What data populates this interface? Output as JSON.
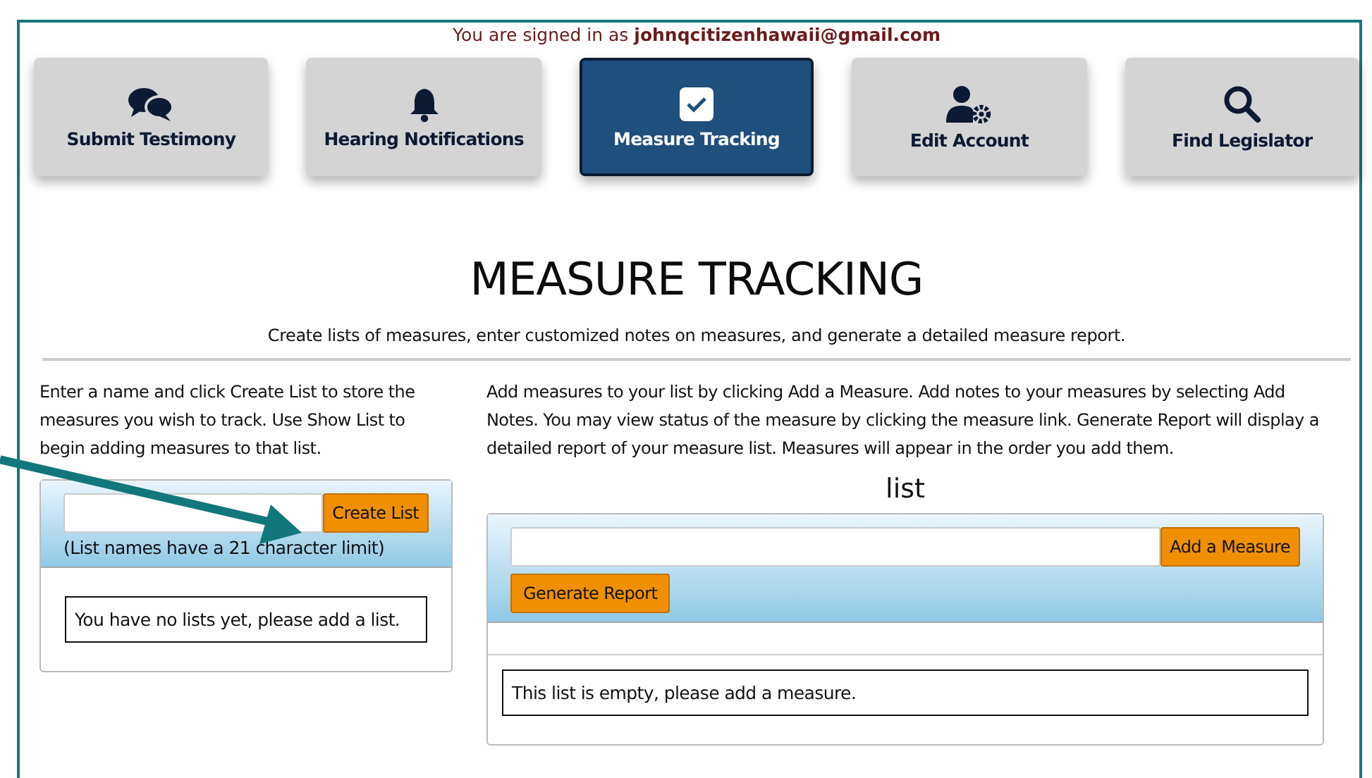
{
  "signed_in": "You are signed in as **johnqcitizenhawaii@gmail.com**",
  "nav": [
    {
      "label": "Submit Testimony",
      "kind": "chat",
      "selected": false
    },
    {
      "label": "Hearing Notifications",
      "kind": "bell",
      "selected": false
    },
    {
      "label": "Measure Tracking",
      "kind": "check",
      "selected": true
    },
    {
      "label": "Edit Account",
      "kind": "usergear",
      "selected": false
    },
    {
      "label": "Find Legislator",
      "kind": "search",
      "selected": false
    }
  ],
  "heading": "MEASURE TRACKING",
  "subheading": "Create lists of measures, enter customized notes on measures, and generate a detailed measure report.",
  "lists_panel": {
    "instructions": "Enter a name and click Create List to store the measures you wish to track. Use Show List to begin adding measures to that list.",
    "create_button": "Create List",
    "hint": "(List names have a 21 character limit)",
    "empty_message": "You have no lists yet, please add a list."
  },
  "measures_panel": {
    "instructions": "Add measures to your list by clicking Add a Measure. Add notes to your measures by selecting Add Notes. You may view status of the measure by clicking the measure link. Generate Report will display a detailed report of your measure list. Measures will appear in the order you add them.",
    "list_title": "list",
    "add_button": "Add a Measure",
    "report_button": "Generate Report",
    "empty_message": "This list is empty, please add a measure."
  },
  "annotation": {
    "kind": "arrow"
  }
}
